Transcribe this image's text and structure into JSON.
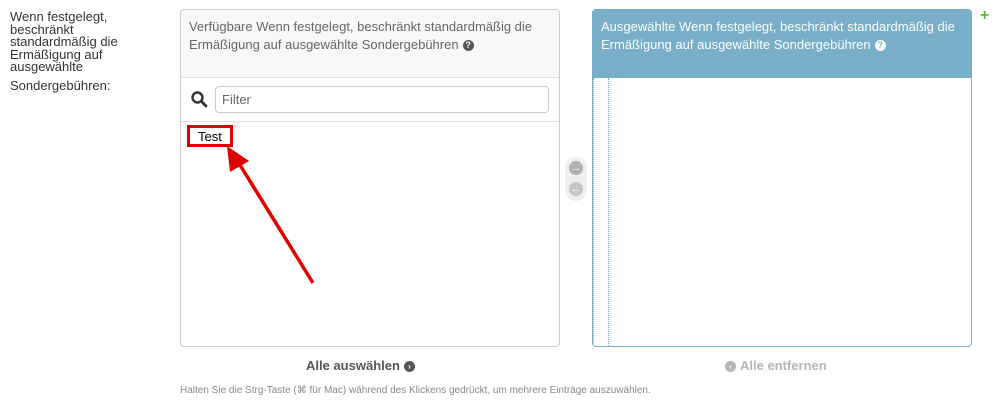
{
  "field": {
    "label_lines": [
      "Wenn festgelegt,",
      "beschränkt",
      "standardmäßig die",
      "Ermäßigung auf",
      "ausgewählte"
    ],
    "label_last": "Sondergebühren:"
  },
  "available": {
    "title": "Verfügbare Wenn festgelegt, beschränkt standardmäßig die Ermäßigung auf ausgewählte Sondergebühren",
    "help_icon_glyph": "?",
    "filter_placeholder": "Filter",
    "filter_value": "",
    "options": [
      "Test"
    ]
  },
  "chosen": {
    "title": "Ausgewählte Wenn festgelegt, beschränkt standardmäßig die Ermäßigung auf ausgewählte Sondergebühren",
    "help_icon_glyph": "?",
    "options": []
  },
  "chooser": {
    "add_glyph": "→",
    "remove_glyph": "←"
  },
  "add_related_glyph": "+",
  "actions": {
    "select_all": "Alle auswählen",
    "select_all_glyph": "›",
    "remove_all": "Alle entfernen",
    "remove_all_glyph": "‹"
  },
  "help_text": "Halten Sie die Strg-Taste (⌘ für Mac) während des Klickens gedrückt, um mehrere Einträge auszuwählen.",
  "colors": {
    "chosen_header": "#79aec8",
    "annotation_red": "#e00000",
    "add_related_green": "#5ab83b"
  }
}
